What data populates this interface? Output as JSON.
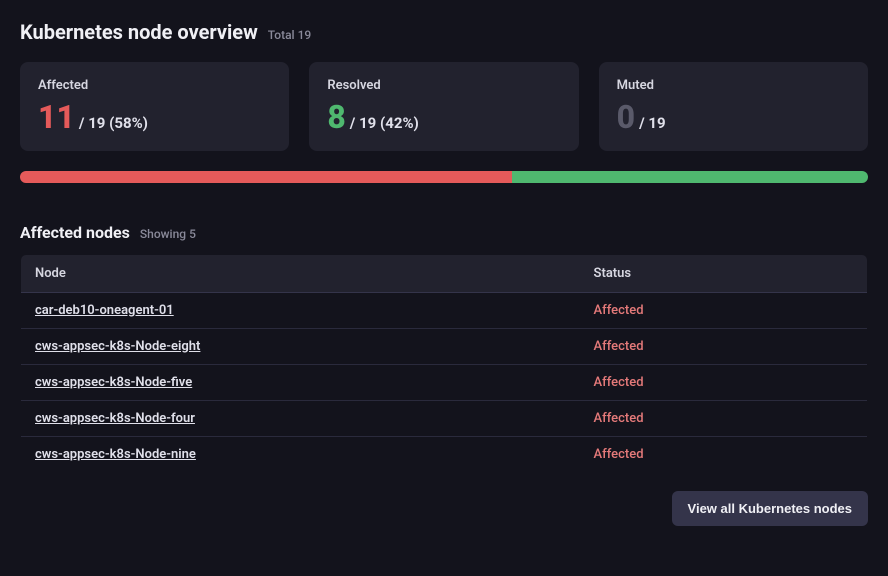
{
  "header": {
    "title": "Kubernetes node overview",
    "subtitle": "Total 19"
  },
  "cards": {
    "affected": {
      "label": "Affected",
      "value": "11",
      "rest": "/ 19 (58%)"
    },
    "resolved": {
      "label": "Resolved",
      "value": "8",
      "rest": "/ 19 (42%)"
    },
    "muted": {
      "label": "Muted",
      "value": "0",
      "rest": "/ 19"
    }
  },
  "progress": {
    "affected_pct": 58,
    "resolved_pct": 42
  },
  "section": {
    "title": "Affected nodes",
    "subtitle": "Showing 5"
  },
  "table": {
    "headers": {
      "node": "Node",
      "status": "Status"
    },
    "rows": [
      {
        "node": "car-deb10-oneagent-01",
        "status": "Affected"
      },
      {
        "node": "cws-appsec-k8s-Node-eight",
        "status": "Affected"
      },
      {
        "node": "cws-appsec-k8s-Node-five",
        "status": "Affected"
      },
      {
        "node": "cws-appsec-k8s-Node-four",
        "status": "Affected"
      },
      {
        "node": "cws-appsec-k8s-Node-nine",
        "status": "Affected"
      }
    ]
  },
  "footer": {
    "view_all": "View all Kubernetes nodes"
  },
  "colors": {
    "affected": "#e55a5a",
    "resolved": "#4fb86f",
    "muted": "#5a5a6a"
  }
}
